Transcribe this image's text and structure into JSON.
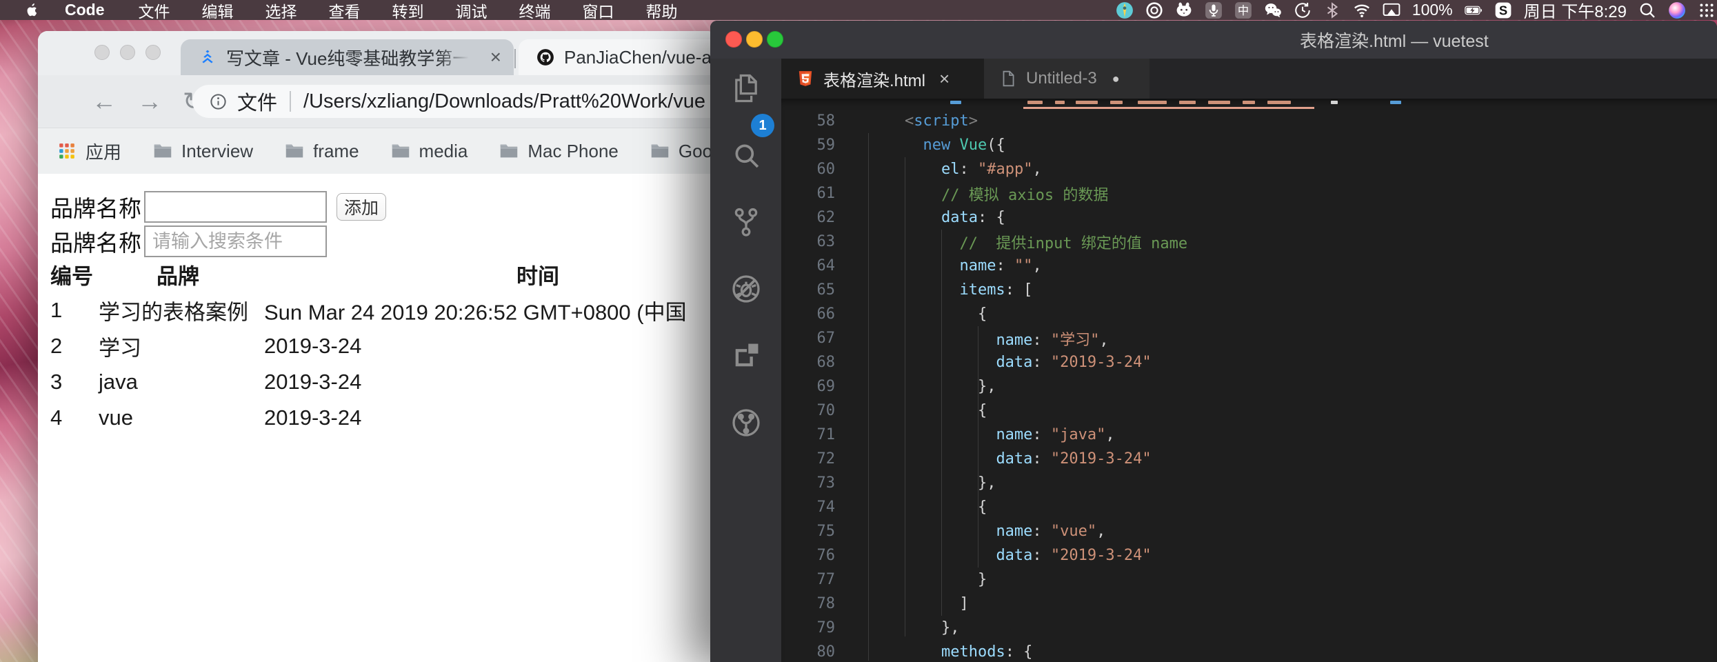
{
  "colors": {
    "menubar_bg": "#4a3a40",
    "vscode_accent_badge": "#1d7fd4",
    "juejin_blue": "#1e80ff",
    "html5_orange": "#e44d26",
    "traffic_red": "#fc5a52",
    "traffic_yellow": "#fdbc2f",
    "traffic_green": "#28c83b"
  },
  "menubar": {
    "apple_icon": "apple-icon",
    "app_name": "Code",
    "menus": [
      "文件",
      "编辑",
      "选择",
      "查看",
      "转到",
      "调试",
      "终端",
      "窗口",
      "帮助"
    ],
    "status_items": [
      {
        "type": "icon",
        "name": "app-circle-icon"
      },
      {
        "type": "icon",
        "name": "record-circle-icon"
      },
      {
        "type": "icon",
        "name": "bunny-icon"
      },
      {
        "type": "icon",
        "name": "dictation-icon"
      },
      {
        "type": "icon",
        "name": "input-source-icon"
      },
      {
        "type": "icon",
        "name": "wechat-icon"
      },
      {
        "type": "icon",
        "name": "time-machine-icon"
      },
      {
        "type": "icon",
        "name": "bluetooth-icon"
      },
      {
        "type": "icon",
        "name": "wifi-icon"
      },
      {
        "type": "icon",
        "name": "screen-mirroring-icon"
      },
      {
        "type": "text",
        "name": "battery-percent",
        "label": "100%"
      },
      {
        "type": "icon",
        "name": "battery-charging-icon"
      },
      {
        "type": "icon",
        "name": "sogou-icon"
      },
      {
        "type": "text",
        "name": "menubar-clock",
        "label": "周日 下午8:29"
      },
      {
        "type": "icon",
        "name": "spotlight-icon"
      },
      {
        "type": "icon",
        "name": "siri-icon"
      },
      {
        "type": "icon",
        "name": "menu-grid-icon"
      }
    ]
  },
  "browser": {
    "tabs": [
      {
        "favicon": "juejin-icon",
        "title": "写文章 - Vue纯零基础教学第一开",
        "close": "×"
      },
      {
        "favicon": "github-icon",
        "title": "PanJiaChen/vue-admin-"
      }
    ],
    "nav": {
      "back": "←",
      "forward": "→",
      "reload": "↻"
    },
    "address": {
      "info_icon": "info-icon",
      "scheme_label": "文件",
      "path": "/Users/xzliang/Downloads/Pratt%20Work/vue"
    },
    "bookmarks": [
      {
        "icon": "apps-grid-icon",
        "label": "应用"
      },
      {
        "icon": "folder-icon",
        "label": "Interview"
      },
      {
        "icon": "folder-icon",
        "label": "frame"
      },
      {
        "icon": "folder-icon",
        "label": "media"
      },
      {
        "icon": "folder-icon",
        "label": "Mac Phone"
      },
      {
        "icon": "folder-icon",
        "label": "Google"
      }
    ],
    "page": {
      "form_rows": [
        {
          "label": "品牌名称",
          "value": "",
          "placeholder": "",
          "button": "添加"
        },
        {
          "label": "品牌名称",
          "value": "",
          "placeholder": "请输入搜索条件",
          "button": ""
        }
      ],
      "table": {
        "headers": [
          "编号",
          "品牌",
          "时间"
        ],
        "rows": [
          [
            "1",
            "学习的表格案例",
            "Sun Mar 24 2019 20:26:52 GMT+0800 (中国"
          ],
          [
            "2",
            "学习",
            "2019-3-24"
          ],
          [
            "3",
            "java",
            "2019-3-24"
          ],
          [
            "4",
            "vue",
            "2019-3-24"
          ]
        ]
      }
    }
  },
  "vscode": {
    "window_title": "表格渲染.html — vuetest",
    "tabs": [
      {
        "icon": "html5-icon",
        "label": "表格渲染.html",
        "close": "×",
        "active": true,
        "dirty": false
      },
      {
        "icon": "file-icon",
        "label": "Untitled-3",
        "close": "",
        "active": false,
        "dirty": true
      }
    ],
    "activity_bar": {
      "badge": "1",
      "icons": [
        "explorer-icon",
        "search-icon",
        "source-control-icon",
        "debug-disabled-icon",
        "extensions-icon",
        "fork-circle-icon"
      ]
    },
    "editor": {
      "lines": [
        {
          "n": 58,
          "indent": 4,
          "tokens": [
            [
              "<",
              "ang"
            ],
            [
              "script",
              "tag"
            ],
            [
              ">",
              "ang"
            ]
          ]
        },
        {
          "n": 59,
          "indent": 6,
          "tokens": [
            [
              "new",
              "kw"
            ],
            [
              " ",
              "pl"
            ],
            [
              "Vue",
              "cls"
            ],
            [
              "({",
              "pl"
            ]
          ]
        },
        {
          "n": 60,
          "indent": 8,
          "tokens": [
            [
              "el",
              "key"
            ],
            [
              ": ",
              "pl"
            ],
            [
              "\"#app\"",
              "str"
            ],
            [
              ",",
              "pl"
            ]
          ]
        },
        {
          "n": 61,
          "indent": 8,
          "tokens": [
            [
              "// 模拟 axios 的数据",
              "cmt"
            ]
          ]
        },
        {
          "n": 62,
          "indent": 8,
          "tokens": [
            [
              "data",
              "key"
            ],
            [
              ": {",
              "pl"
            ]
          ]
        },
        {
          "n": 63,
          "indent": 10,
          "tokens": [
            [
              "//  提供input 绑定的值 name",
              "cmt"
            ]
          ]
        },
        {
          "n": 64,
          "indent": 10,
          "tokens": [
            [
              "name",
              "key"
            ],
            [
              ": ",
              "pl"
            ],
            [
              "\"\"",
              "str"
            ],
            [
              ",",
              "pl"
            ]
          ]
        },
        {
          "n": 65,
          "indent": 10,
          "tokens": [
            [
              "items",
              "key"
            ],
            [
              ": [",
              "pl"
            ]
          ]
        },
        {
          "n": 66,
          "indent": 12,
          "tokens": [
            [
              "{",
              "pl"
            ]
          ]
        },
        {
          "n": 67,
          "indent": 14,
          "tokens": [
            [
              "name",
              "key"
            ],
            [
              ": ",
              "pl"
            ],
            [
              "\"学习\"",
              "str"
            ],
            [
              ",",
              "pl"
            ]
          ]
        },
        {
          "n": 68,
          "indent": 14,
          "tokens": [
            [
              "data",
              "key"
            ],
            [
              ": ",
              "pl"
            ],
            [
              "\"2019-3-24\"",
              "str"
            ]
          ]
        },
        {
          "n": 69,
          "indent": 12,
          "tokens": [
            [
              "},",
              "pl"
            ]
          ]
        },
        {
          "n": 70,
          "indent": 12,
          "tokens": [
            [
              "{",
              "pl"
            ]
          ]
        },
        {
          "n": 71,
          "indent": 14,
          "tokens": [
            [
              "name",
              "key"
            ],
            [
              ": ",
              "pl"
            ],
            [
              "\"java\"",
              "str"
            ],
            [
              ",",
              "pl"
            ]
          ]
        },
        {
          "n": 72,
          "indent": 14,
          "tokens": [
            [
              "data",
              "key"
            ],
            [
              ": ",
              "pl"
            ],
            [
              "\"2019-3-24\"",
              "str"
            ]
          ]
        },
        {
          "n": 73,
          "indent": 12,
          "tokens": [
            [
              "},",
              "pl"
            ]
          ]
        },
        {
          "n": 74,
          "indent": 12,
          "tokens": [
            [
              "{",
              "pl"
            ]
          ]
        },
        {
          "n": 75,
          "indent": 14,
          "tokens": [
            [
              "name",
              "key"
            ],
            [
              ": ",
              "pl"
            ],
            [
              "\"vue\"",
              "str"
            ],
            [
              ",",
              "pl"
            ]
          ]
        },
        {
          "n": 76,
          "indent": 14,
          "tokens": [
            [
              "data",
              "key"
            ],
            [
              ": ",
              "pl"
            ],
            [
              "\"2019-3-24\"",
              "str"
            ]
          ]
        },
        {
          "n": 77,
          "indent": 12,
          "tokens": [
            [
              "}",
              "pl"
            ]
          ]
        },
        {
          "n": 78,
          "indent": 10,
          "tokens": [
            [
              "]",
              "pl"
            ]
          ]
        },
        {
          "n": 79,
          "indent": 8,
          "tokens": [
            [
              "},",
              "pl"
            ]
          ]
        },
        {
          "n": 80,
          "indent": 8,
          "tokens": [
            [
              "methods",
              "key"
            ],
            [
              ": {",
              "pl"
            ]
          ]
        }
      ]
    }
  }
}
